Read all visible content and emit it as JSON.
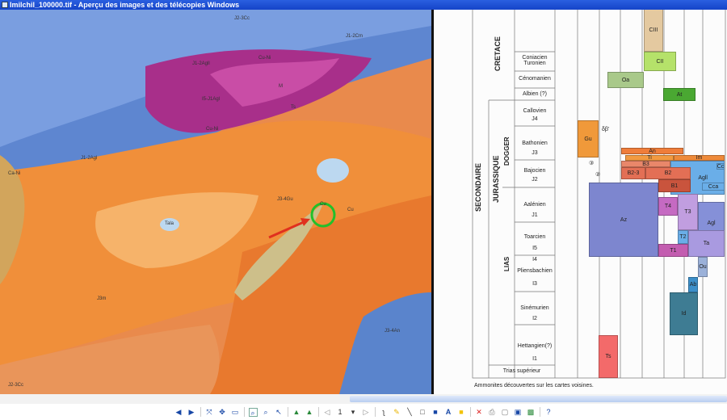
{
  "window": {
    "title": "Imilchil_100000.tif - Aperçu des images et des télécopies Windows"
  },
  "map": {
    "labels": [
      "J2-3Cc",
      "J1-2Cm",
      "J1-2Agll",
      "Cu-Ni",
      "Ts",
      "M",
      "I5-J1Agl",
      "Cu-Ni",
      "J1-2Agl",
      "Ca-Ni",
      "J3-4Gu",
      "Cu",
      "Cu",
      "Tala",
      "J3m",
      "J3-4An",
      "J2-3Cc"
    ],
    "annotations": {
      "arrow_color": "#e0301e",
      "circle_color": "#22c02a"
    }
  },
  "chart": {
    "eras": {
      "secondaire": "SECONDAIRE"
    },
    "systems": {
      "cretace": "CRETACE",
      "jurassique": "JURASSIQUE"
    },
    "series": {
      "dogger": "DOGGER",
      "lias": "LIAS"
    },
    "stages": [
      {
        "name": "Coniacien Turonien"
      },
      {
        "name": "Cénomanien"
      },
      {
        "name": "Albien (?)"
      },
      {
        "name": "Callovien",
        "code": "J4"
      },
      {
        "name": "Bathonien",
        "code": "J3"
      },
      {
        "name": "Bajocien",
        "code": "J2"
      },
      {
        "name": "Aalénien",
        "code": "J1"
      },
      {
        "name": "Toarcien",
        "code": "I5"
      },
      {
        "name": "Pliensbachien",
        "code": "I3",
        "code2": "I4"
      },
      {
        "name": "Sinémurien",
        "code": "I2"
      },
      {
        "name": "Hettangien(?)",
        "code": "I1"
      },
      {
        "name": "Trias supérieur"
      }
    ],
    "units": [
      {
        "label": "CIII",
        "color": "#e4c9a0"
      },
      {
        "label": "CII",
        "color": "#b5e26a"
      },
      {
        "label": "Oa",
        "color": "#a9c98a"
      },
      {
        "label": "At",
        "color": "#4aa832"
      },
      {
        "label": "Gu",
        "color": "#f0993a"
      },
      {
        "label": "An",
        "color": "#ef7d3a"
      },
      {
        "label": "Ti",
        "color": "#f29a40"
      },
      {
        "label": "Im",
        "color": "#ee8a3a"
      },
      {
        "label": "B3",
        "color": "#e9876a"
      },
      {
        "label": "B2-3",
        "color": "#e36f55"
      },
      {
        "label": "B2",
        "color": "#e36f55"
      },
      {
        "label": "B1",
        "color": "#c9543d"
      },
      {
        "label": "Agll",
        "color": "#6aaee8"
      },
      {
        "label": "Cc",
        "color": "#6aaee8"
      },
      {
        "label": "Cca",
        "color": "#6aaee8"
      },
      {
        "label": "Az",
        "color": "#7d86cf"
      },
      {
        "label": "T4",
        "color": "#c56ac2"
      },
      {
        "label": "T3",
        "color": "#c19ee0"
      },
      {
        "label": "Agl",
        "color": "#8590d8"
      },
      {
        "label": "T2",
        "color": "#6aaee8"
      },
      {
        "label": "T1",
        "color": "#c35db0"
      },
      {
        "label": "Ta",
        "color": "#a99ae0"
      },
      {
        "label": "Ou",
        "color": "#9bb1d9"
      },
      {
        "label": "Ab",
        "color": "#3d8fc9"
      },
      {
        "label": "Id",
        "color": "#3e7c93"
      },
      {
        "label": "Ts",
        "color": "#f36a6a"
      }
    ],
    "markers": [
      "③",
      "②",
      "①",
      "δβ'"
    ],
    "footnote": "Ammonites découvertes sur les cartes voisines."
  },
  "toolbar": {
    "icons": [
      "previous-image",
      "next-image",
      "best-fit",
      "actual-size",
      "slideshow",
      "zoom-in",
      "zoom-out",
      "select",
      "rotate-clockwise",
      "rotate-counterclockwise",
      "previous-page",
      "page-number",
      "next-page",
      "annotation-pen",
      "highlighter",
      "line",
      "rectangle",
      "filled-rectangle",
      "text",
      "note",
      "delete",
      "print",
      "copy",
      "save",
      "edit",
      "help"
    ],
    "page": "1"
  }
}
